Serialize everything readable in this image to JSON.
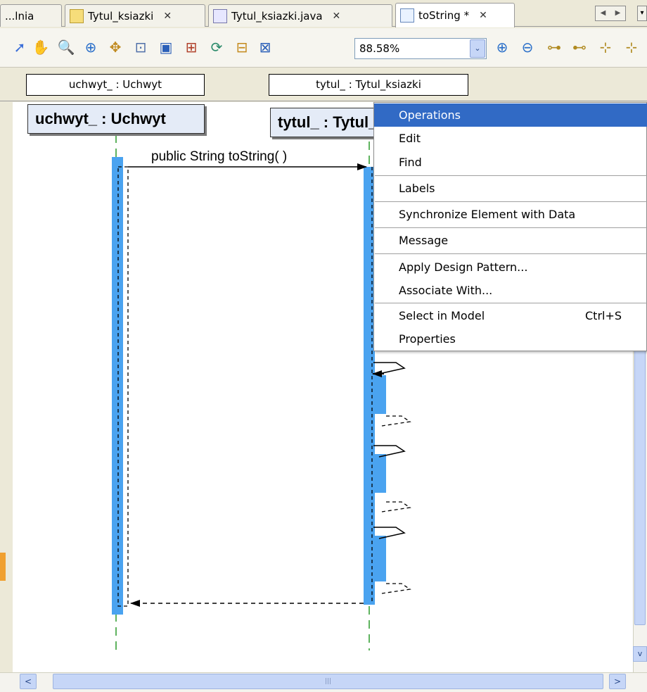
{
  "tabs": [
    {
      "label": "...lnia",
      "icon": "none"
    },
    {
      "label": "Tytul_ksiazki",
      "icon": "package-icon"
    },
    {
      "label": "Tytul_ksiazki.java",
      "icon": "java-class-icon"
    },
    {
      "label": "toString *",
      "icon": "sequence-diagram-icon"
    }
  ],
  "toolbar": {
    "zoom_value": "88.58%",
    "zoom_dropdown_glyph": "⌄",
    "tools": [
      {
        "name": "select-arrow-icon",
        "glyph": "➚",
        "color": "#3a6ed8"
      },
      {
        "name": "hand-pan-icon",
        "glyph": "✋",
        "color": "#d9a520"
      },
      {
        "name": "magnifier-icon",
        "glyph": "🔍",
        "color": "#2a6fc9"
      },
      {
        "name": "zoom-in-icon",
        "glyph": "⊕",
        "color": "#2a6fc9"
      },
      {
        "name": "move-icon",
        "glyph": "✥",
        "color": "#c08a20"
      },
      {
        "name": "fit-page-icon",
        "glyph": "⊡",
        "color": "#4f6fa8"
      },
      {
        "name": "overview-icon",
        "glyph": "▣",
        "color": "#2b5fb8"
      },
      {
        "name": "layout-icon",
        "glyph": "⊞",
        "color": "#b0402a"
      },
      {
        "name": "refresh-icon",
        "glyph": "⟳",
        "color": "#2a8a6a"
      },
      {
        "name": "diagram-tool-icon",
        "glyph": "⊟",
        "color": "#c48a1c"
      },
      {
        "name": "expand-icon",
        "glyph": "⊠",
        "color": "#2a5fb8"
      },
      {
        "name": "zoom-in-glass-icon",
        "glyph": "⊕",
        "color": "#2a6fc9"
      },
      {
        "name": "zoom-out-glass-icon",
        "glyph": "⊖",
        "color": "#2a6fc9"
      },
      {
        "name": "hierarchy-icon",
        "glyph": "⊶",
        "color": "#b08a20"
      },
      {
        "name": "hierarchy-2-icon",
        "glyph": "⊷",
        "color": "#b08a20"
      },
      {
        "name": "hierarchy-3-icon",
        "glyph": "⊹",
        "color": "#b08a20"
      },
      {
        "name": "hierarchy-4-icon",
        "glyph": "⊹",
        "color": "#b08a20"
      }
    ]
  },
  "lifeline_headers": [
    "uchwyt_ : Uchwyt",
    "tytul_ : Tytul_ksiazki"
  ],
  "diagram": {
    "objects": [
      "uchwyt_ : Uchwyt",
      "tytul_ : Tytul_ksiazki"
    ],
    "message": "public String  toString( )",
    "accent_color": "#4aa3f0"
  },
  "context_menu": {
    "items": [
      {
        "label": "Operations",
        "shortcut": "",
        "selected": true
      },
      {
        "label": "Edit",
        "shortcut": "",
        "selected": false
      },
      {
        "label": "Find",
        "shortcut": "",
        "selected": false
      },
      {
        "label": "Labels",
        "shortcut": "",
        "selected": false
      },
      {
        "label": "Synchronize Element with Data",
        "shortcut": "",
        "selected": false
      },
      {
        "label": "Message",
        "shortcut": "",
        "selected": false
      },
      {
        "label": "Apply Design Pattern...",
        "shortcut": "",
        "selected": false
      },
      {
        "label": "Associate With...",
        "shortcut": "",
        "selected": false
      },
      {
        "label": "Select in Model",
        "shortcut": "Ctrl+S",
        "selected": false
      },
      {
        "label": "Properties",
        "shortcut": "",
        "selected": false
      }
    ],
    "highlight_color": "#316ac5"
  },
  "scrollbars": {
    "left_arrow": "<",
    "right_arrow": ">",
    "down_arrow": "v",
    "grip": "|||"
  }
}
